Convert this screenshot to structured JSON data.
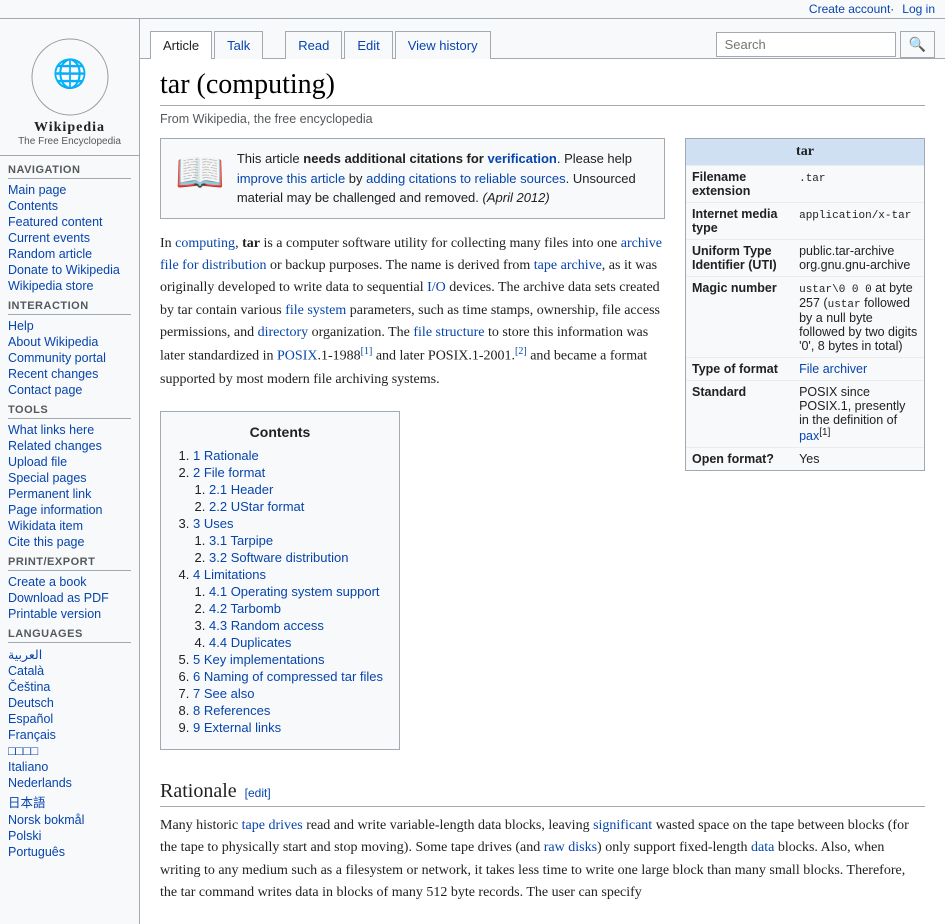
{
  "topbar": {
    "create_account": "Create account",
    "log_in": "Log in"
  },
  "sidebar": {
    "logo_text": "Wikipedia",
    "logo_sub": "The Free Encyclopedia",
    "navigation": {
      "title": "Navigation",
      "items": [
        {
          "label": "Main page",
          "href": "#"
        },
        {
          "label": "Contents",
          "href": "#"
        },
        {
          "label": "Featured content",
          "href": "#"
        },
        {
          "label": "Current events",
          "href": "#"
        },
        {
          "label": "Random article",
          "href": "#"
        },
        {
          "label": "Donate to Wikipedia",
          "href": "#"
        },
        {
          "label": "Wikipedia store",
          "href": "#"
        }
      ]
    },
    "interaction": {
      "title": "Interaction",
      "items": [
        {
          "label": "Help",
          "href": "#"
        },
        {
          "label": "About Wikipedia",
          "href": "#"
        },
        {
          "label": "Community portal",
          "href": "#"
        },
        {
          "label": "Recent changes",
          "href": "#"
        },
        {
          "label": "Contact page",
          "href": "#"
        }
      ]
    },
    "tools": {
      "title": "Tools",
      "items": [
        {
          "label": "What links here",
          "href": "#"
        },
        {
          "label": "Related changes",
          "href": "#"
        },
        {
          "label": "Upload file",
          "href": "#"
        },
        {
          "label": "Special pages",
          "href": "#"
        },
        {
          "label": "Permanent link",
          "href": "#"
        },
        {
          "label": "Page information",
          "href": "#"
        },
        {
          "label": "Wikidata item",
          "href": "#"
        },
        {
          "label": "Cite this page",
          "href": "#"
        }
      ]
    },
    "print_export": {
      "title": "Print/export",
      "items": [
        {
          "label": "Create a book",
          "href": "#"
        },
        {
          "label": "Download as PDF",
          "href": "#"
        },
        {
          "label": "Printable version",
          "href": "#"
        }
      ]
    },
    "languages": {
      "title": "Languages",
      "items": [
        {
          "label": "العربية"
        },
        {
          "label": "Català"
        },
        {
          "label": "Čeština"
        },
        {
          "label": "Deutsch"
        },
        {
          "label": "Español"
        },
        {
          "label": "Français"
        },
        {
          "label": "□□□□"
        },
        {
          "label": "Italiano"
        },
        {
          "label": "Nederlands"
        },
        {
          "label": "日本語"
        },
        {
          "label": "Norsk bokmål"
        },
        {
          "label": "Polski"
        },
        {
          "label": "Português"
        }
      ]
    }
  },
  "tabs": {
    "article": "Article",
    "talk": "Talk",
    "read": "Read",
    "edit": "Edit",
    "view_history": "View history",
    "search_placeholder": "Search"
  },
  "article": {
    "title": "tar (computing)",
    "subtitle": "From Wikipedia, the free encyclopedia",
    "warning": {
      "text_before": "This article ",
      "needs": "needs additional citations for",
      "verification": "verification",
      "text_after": ". Please help",
      "improve": "improve this article",
      "by": " by",
      "adding": "adding citations to reliable sources",
      "unsourced": ". Unsourced material may be challenged and removed.",
      "date": "(April 2012)"
    },
    "infobox": {
      "title": "tar",
      "rows": [
        {
          "label": "Filename extension",
          "value": ".tar"
        },
        {
          "label": "Internet media type",
          "value": "application/x-tar"
        },
        {
          "label": "Uniform Type Identifier (UTI)",
          "value": "public.tar-archive org.gnu.gnu-archive"
        },
        {
          "label": "Magic number",
          "value": "ustar\\0 0 0 at byte 257 (ustar followed by a null byte followed by two digits '0', 8 bytes in total)"
        },
        {
          "label": "Type of format",
          "value": "File archiver"
        },
        {
          "label": "Standard",
          "value": "POSIX since POSIX.1, presently in the definition of pax[1]"
        },
        {
          "label": "Open format?",
          "value": "Yes"
        }
      ]
    },
    "intro": "In computing, tar is a computer software utility for collecting many files into one archive file for distribution or backup purposes. The name is derived from tape archive, as it was originally developed to write data to sequential I/O devices. The archive data sets created by tar contain various file system parameters, such as time stamps, ownership, file access permissions, and directory organization. The file structure to store this information was later standardized in POSIX.1-1988[1] and later POSIX.1-2001.[2] and became a format supported by most modern file archiving systems.",
    "toc": {
      "title": "Contents",
      "items": [
        {
          "num": "1",
          "label": "Rationale"
        },
        {
          "num": "2",
          "label": "File format",
          "sub": [
            {
              "num": "2.1",
              "label": "Header"
            },
            {
              "num": "2.2",
              "label": "UStar format"
            }
          ]
        },
        {
          "num": "3",
          "label": "Uses",
          "sub": [
            {
              "num": "3.1",
              "label": "Tarpipe"
            },
            {
              "num": "3.2",
              "label": "Software distribution"
            }
          ]
        },
        {
          "num": "4",
          "label": "Limitations",
          "sub": [
            {
              "num": "4.1",
              "label": "Operating system support"
            },
            {
              "num": "4.2",
              "label": "Tarbomb"
            },
            {
              "num": "4.3",
              "label": "Random access"
            },
            {
              "num": "4.4",
              "label": "Duplicates"
            }
          ]
        },
        {
          "num": "5",
          "label": "Key implementations"
        },
        {
          "num": "6",
          "label": "Naming of compressed tar files"
        },
        {
          "num": "7",
          "label": "See also"
        },
        {
          "num": "8",
          "label": "References"
        },
        {
          "num": "9",
          "label": "External links"
        }
      ]
    },
    "rationale_heading": "Rationale",
    "rationale_edit": "[edit]",
    "rationale_text": "Many historic tape drives read and write variable-length data blocks, leaving significant wasted space on the tape between blocks (for the tape to physically start and stop moving). Some tape drives (and raw disks) only support fixed-length data blocks. Also, when writing to any medium such as a filesystem or network, it takes less time to write one large block than many small blocks. Therefore, the tar command writes data in blocks of many 512 byte records. The user can specify"
  }
}
